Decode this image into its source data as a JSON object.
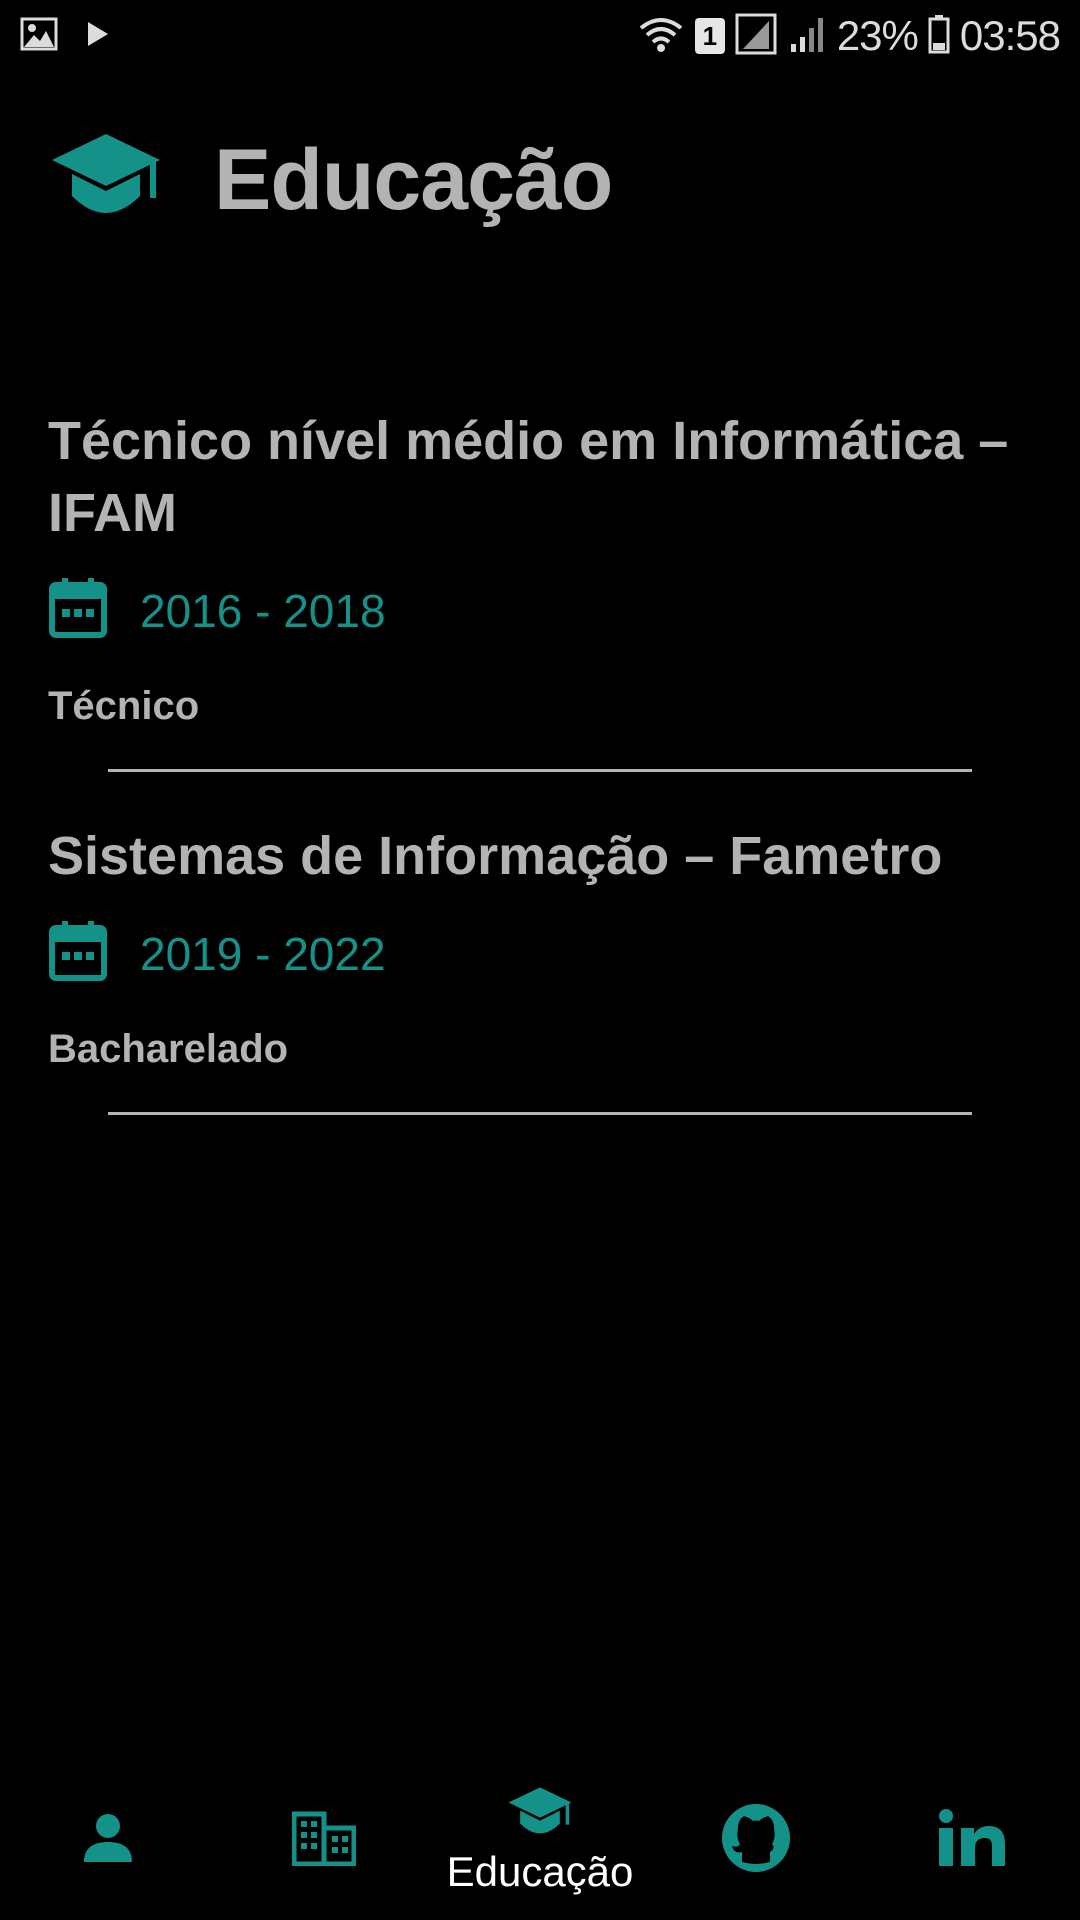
{
  "status_bar": {
    "battery_percent": "23%",
    "time": "03:58",
    "sim_slot": "1"
  },
  "header": {
    "title": "Educação",
    "icon": "graduation-cap-icon"
  },
  "education": [
    {
      "title": "Técnico nível médio em Informática – IFAM",
      "dates": "2016 - 2018",
      "type": "Técnico"
    },
    {
      "title": "Sistemas de Informação – Fametro",
      "dates": "2019 - 2022",
      "type": "Bacharelado"
    }
  ],
  "bottom_nav": {
    "items": [
      {
        "icon": "person-icon",
        "label": ""
      },
      {
        "icon": "building-icon",
        "label": ""
      },
      {
        "icon": "graduation-cap-icon",
        "label": "Educação",
        "active": true
      },
      {
        "icon": "github-icon",
        "label": ""
      },
      {
        "icon": "linkedin-icon",
        "label": ""
      }
    ]
  },
  "colors": {
    "accent": "#14928a",
    "text": "#b3b3b3",
    "background": "#000000"
  }
}
